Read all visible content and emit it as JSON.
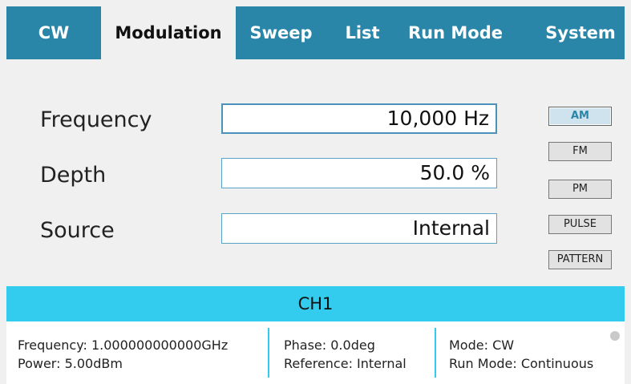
{
  "tabs": [
    {
      "label": "CW"
    },
    {
      "label": "Modulation"
    },
    {
      "label": "Sweep"
    },
    {
      "label": "List"
    },
    {
      "label": "Run Mode"
    },
    {
      "label": "System"
    }
  ],
  "form": {
    "frequency": {
      "label": "Frequency",
      "value": "10,000 Hz"
    },
    "depth": {
      "label": "Depth",
      "value": "50.0 %"
    },
    "source": {
      "label": "Source",
      "value": "Internal"
    }
  },
  "modulation_buttons": [
    {
      "label": "AM",
      "active": true
    },
    {
      "label": "FM"
    },
    {
      "label": "PM"
    },
    {
      "label": "PULSE"
    },
    {
      "label": "PATTERN"
    }
  ],
  "channel": {
    "label": "CH1"
  },
  "status": {
    "frequency": "Frequency: 1.000000000000GHz",
    "power": "Power: 5.00dBm",
    "phase": "Phase: 0.0deg",
    "reference": "Reference: Internal",
    "mode": "Mode: CW",
    "run_mode": "Run Mode: Continuous"
  },
  "colors": {
    "tab_bar": "#2a86a9",
    "channel_banner": "#33ccef"
  }
}
